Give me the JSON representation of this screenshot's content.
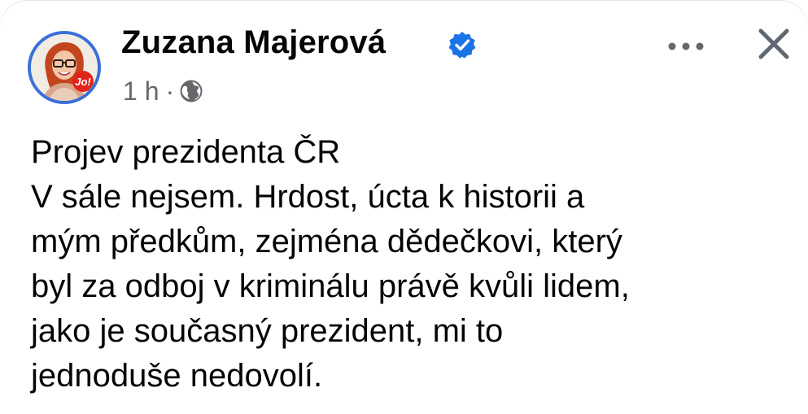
{
  "post": {
    "author": "Zuzana Majerová",
    "verified_icon": "verified-badge-icon",
    "time": "1 h",
    "separator": "·",
    "audience_icon": "globe-icon",
    "avatar_badge": "Jo!",
    "lines": [
      "Projev prezidenta ČR",
      "V sále nejsem. Hrdost, úcta k historii a",
      "mým předkům, zejména dědečkovi, který",
      "byl za odboj v kriminálu právě kvůli lidem,",
      "jako je současný prezident, mi to",
      "jednoduše nedovolí."
    ]
  },
  "actions": {
    "more_icon": "more-options-icon",
    "close_icon": "close-icon"
  },
  "colors": {
    "verified_blue": "#1b74e4",
    "avatar_ring": "#3b6fd8",
    "meta_gray": "#65676b",
    "text": "#050505"
  }
}
